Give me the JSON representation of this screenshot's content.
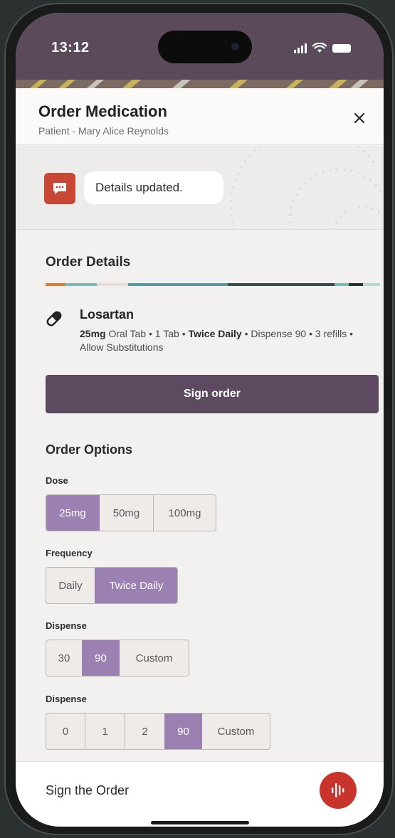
{
  "status_bar": {
    "time": "13:12"
  },
  "header": {
    "title": "Order Medication",
    "subtitle": "Patient - Mary Alice Reynolds",
    "close_icon": "close-icon"
  },
  "toast": {
    "icon": "chat-bubble-icon",
    "text": "Details updated."
  },
  "order_details": {
    "heading": "Order Details",
    "medication": {
      "icon": "pill-icon",
      "name": "Losartan",
      "dose": "25mg",
      "part1": " Oral Tab • 1 Tab • ",
      "frequency": "Twice Daily",
      "part2": " • Dispense 90 • 3 refills • Allow Substitutions"
    },
    "sign_button": "Sign order"
  },
  "order_options": {
    "heading": "Order Options",
    "groups": [
      {
        "label": "Dose",
        "options": [
          "25mg",
          "50mg",
          "100mg"
        ],
        "selected": "25mg"
      },
      {
        "label": "Frequency",
        "options": [
          "Daily",
          "Twice Daily"
        ],
        "selected": "Twice Daily"
      },
      {
        "label": "Dispense",
        "options": [
          "30",
          "90",
          "Custom"
        ],
        "selected": "90"
      },
      {
        "label": "Dispense",
        "options": [
          "0",
          "1",
          "2",
          "90",
          "Custom"
        ],
        "selected": "90"
      }
    ]
  },
  "bottom_bar": {
    "text": "Sign the Order",
    "voice_icon": "voice-waveform-icon"
  },
  "colors": {
    "brand_purple": "#5d4a60",
    "selected_option": "#9a81b2",
    "alert_red": "#c74634",
    "voice_red": "#c8332b"
  }
}
